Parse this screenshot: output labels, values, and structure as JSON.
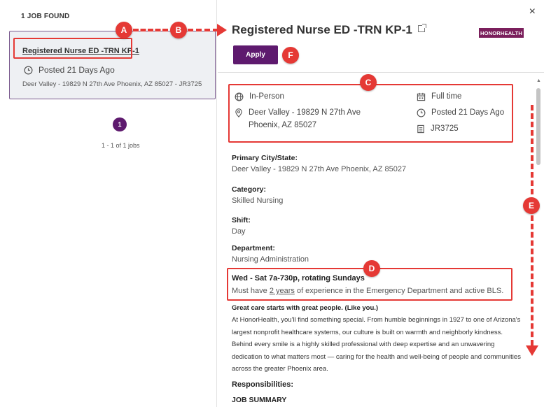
{
  "left": {
    "count": "1 JOB FOUND",
    "card": {
      "title": "Registered Nurse ED -TRN KP-1",
      "posted": "Posted 21 Days Ago",
      "location": "Deer Valley - 19829 N 27th Ave Phoenix, AZ 85027 - JR3725"
    },
    "pager": {
      "page": "1",
      "info": "1 - 1 of 1 jobs"
    }
  },
  "detail": {
    "title": "Registered Nurse ED -TRN KP-1",
    "logo_text": "HONORHEALTH",
    "apply_label": "Apply",
    "close_label": "×",
    "meta": {
      "workplace": "In-Person",
      "address_line1": "Deer Valley - 19829 N 27th Ave",
      "address_line2": "Phoenix, AZ 85027",
      "time_type": "Full time",
      "posted": "Posted 21 Days Ago",
      "req_id": "JR3725"
    },
    "fields": [
      {
        "label": "Primary City/State:",
        "value": "Deer Valley - 19829 N 27th Ave Phoenix, AZ 85027"
      },
      {
        "label": "Category:",
        "value": "Skilled Nursing"
      },
      {
        "label": "Shift:",
        "value": "Day"
      },
      {
        "label": "Department:",
        "value": "Nursing Administration"
      }
    ],
    "schedule": {
      "heading": "Wed - Sat 7a-730p, rotating Sundays",
      "req_pre": "Must have ",
      "req_link": "2 years",
      "req_post": " of experience in the Emergency Department and active BLS."
    },
    "tagline": "Great care starts with great people. (Like you.)",
    "about_lines": [
      "At HonorHealth, you'll find something special. From humble beginnings in 1927 to one of Arizona's",
      "largest nonprofit healthcare systems, our culture is built on warmth and neighborly kindness.",
      "Behind every smile is a highly skilled professional with deep expertise and an unwavering",
      "dedication to what matters most — caring for the health and well-being of people and communities",
      "across the greater Phoenix area."
    ],
    "responsibilities": "Responsibilities:",
    "job_summary": "JOB SUMMARY"
  },
  "annotations": {
    "labels": [
      "A",
      "B",
      "C",
      "D",
      "E",
      "F"
    ],
    "color": "#e53935"
  },
  "colors": {
    "brand": "#5e1a6e",
    "logo": "#7b1f5c",
    "card_bg": "#eef0f3"
  }
}
